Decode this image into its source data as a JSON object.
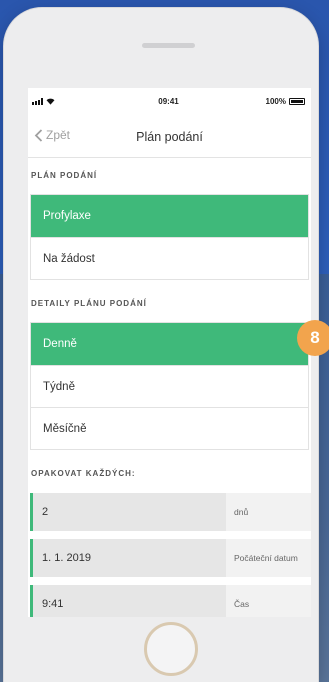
{
  "status_bar": {
    "time": "09:41",
    "battery": "100%"
  },
  "nav": {
    "back_label": "Zpět",
    "title": "Plán podání"
  },
  "plan_section": {
    "header": "PLÁN PODÁNÍ",
    "options": [
      {
        "label": "Profylaxe",
        "selected": true
      },
      {
        "label": "Na žádost",
        "selected": false
      }
    ]
  },
  "details_section": {
    "header": "DETAILY PLÁNU PODÁNÍ",
    "options": [
      {
        "label": "Denně",
        "selected": true
      },
      {
        "label": "Týdně",
        "selected": false
      },
      {
        "label": "Měsíčně",
        "selected": false
      }
    ]
  },
  "repeat_section": {
    "header": "OPAKOVAT KAŽDÝCH:",
    "fields": [
      {
        "value": "2",
        "label": "dnů"
      },
      {
        "value": "1. 1. 2019",
        "label": "Počáteční datum"
      },
      {
        "value": "9:41",
        "label": "Čas"
      }
    ]
  },
  "step_badge": "8",
  "colors": {
    "accent": "#3fb97a",
    "badge": "#f2a44d",
    "background": "#2d5fbb"
  }
}
